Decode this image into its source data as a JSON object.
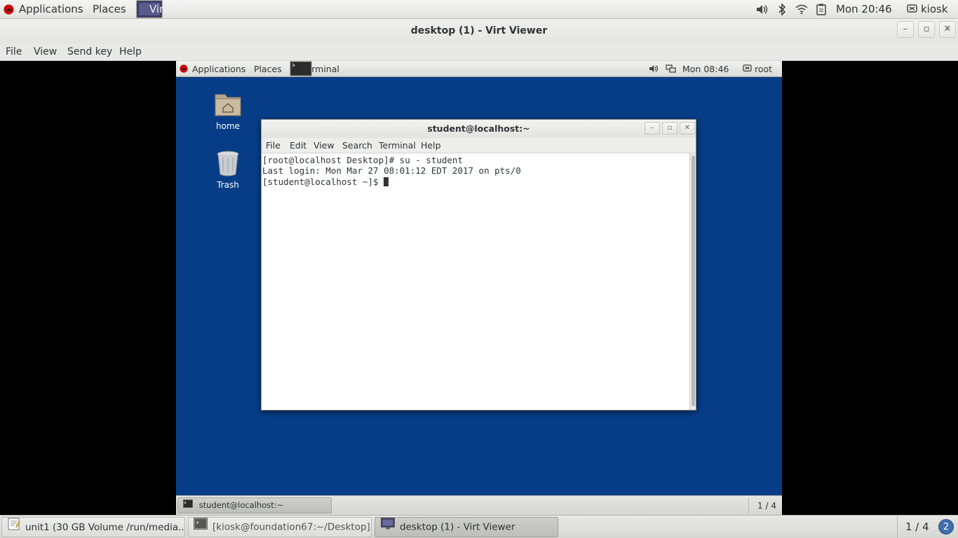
{
  "host_top_panel": {
    "applications": "Applications",
    "places": "Places",
    "active_app": "Virt-viewer",
    "clock": "Mon 20:46",
    "user": "kiosk"
  },
  "window": {
    "title": "desktop (1) - Virt Viewer",
    "menu": [
      "File",
      "View",
      "Send key",
      "Help"
    ]
  },
  "guest": {
    "top_panel": {
      "applications": "Applications",
      "places": "Places",
      "active_app": "Terminal",
      "clock": "Mon 08:46",
      "user": "root"
    },
    "desktop_icons": [
      "home",
      "Trash"
    ],
    "terminal": {
      "title": "student@localhost:~",
      "menu": [
        "File",
        "Edit",
        "View",
        "Search",
        "Terminal",
        "Help"
      ],
      "lines": [
        "[root@localhost Desktop]# su - student",
        "Last login: Mon Mar 27 08:01:12 EDT 2017 on pts/0",
        "[student@localhost ~]$ "
      ]
    },
    "bottom_panel": {
      "task": "student@localhost:~",
      "workspace": "1 / 4"
    }
  },
  "host_bottom_panel": {
    "tasks": [
      "unit1 (30 GB Volume /run/media...",
      "[kiosk@foundation67:~/Desktop]",
      "desktop (1) - Virt Viewer"
    ],
    "workspace": "1 / 4",
    "notification_count": "2"
  },
  "colors": {
    "guest_desktop": "#063d86",
    "panel": "#e8e8e6",
    "redhat": "#cc0000"
  }
}
